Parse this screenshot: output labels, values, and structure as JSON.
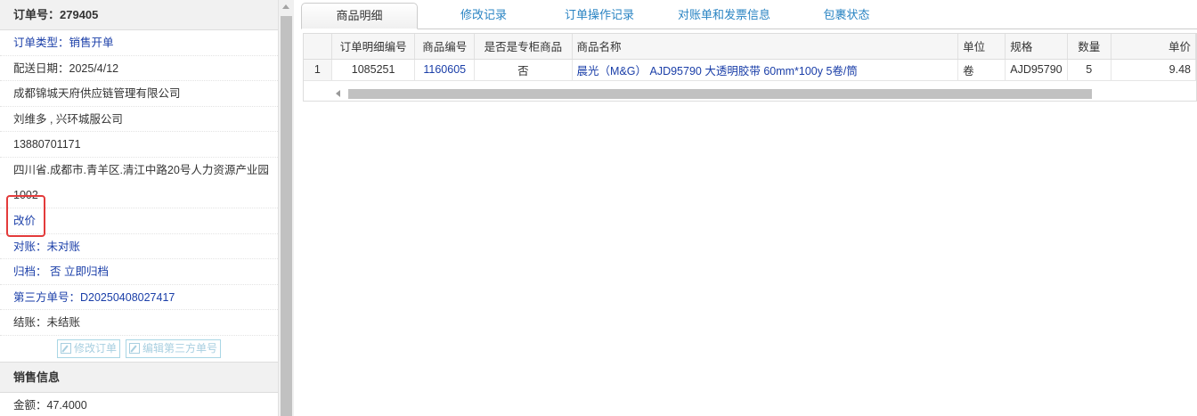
{
  "order": {
    "header": "订单号：279405",
    "type": "订单类型：销售开单",
    "delivery_date": "配送日期：2025/4/12",
    "company": "成都锦城天府供应链管理有限公司",
    "contact": "刘维多 , 兴环城服公司",
    "phone": "13880701171",
    "address": "四川省.成都市.青羊区.清江中路20号人力资源产业园1002",
    "change_price": "改价",
    "reconcile": "对账：未对账",
    "archive": "归档：  否  立即归档",
    "third_party_no": "第三方单号：D20250408027417",
    "settlement": "结账：未结账",
    "btn_edit_order": "修改订单",
    "btn_edit_third": "编辑第三方单号"
  },
  "sales": {
    "header": "销售信息",
    "amount": "金额：47.4000"
  },
  "tabs": [
    "商品明细",
    "修改记录",
    "订单操作记录",
    "对账单和发票信息",
    "包裹状态"
  ],
  "grid": {
    "columns": [
      "订单明细编号",
      "商品编号",
      "是否是专柜商品",
      "商品名称",
      "单位",
      "规格",
      "数量",
      "单价"
    ],
    "rows": [
      [
        "1",
        "1085251",
        "1160605",
        "否",
        "晨光（M&G） AJD95790 大透明胶带 60mm*100y 5卷/筒",
        "卷",
        "AJD95790",
        "5",
        "9.48"
      ]
    ]
  }
}
